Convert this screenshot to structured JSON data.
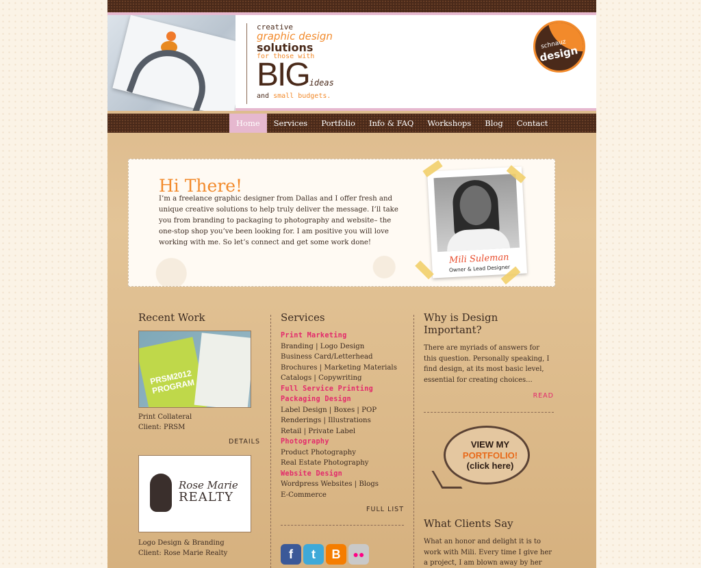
{
  "header": {
    "tag_creative": "creative",
    "tag_graphic_design": "graphic design",
    "tag_solutions": "solutions",
    "tag_for_those_with": "for those with",
    "tag_big": "BIG",
    "tag_ideas": "ideas",
    "tag_and": "and",
    "tag_small_budgets": "small budgets.",
    "logo_line1": "schnauz",
    "logo_line2": "design"
  },
  "nav": {
    "items": [
      "Home",
      "Services",
      "Portfolio",
      "Info & FAQ",
      "Workshops",
      "Blog",
      "Contact"
    ],
    "active": "Home"
  },
  "intro": {
    "heading": "Hi There!",
    "text": "I’m a freelance graphic designer from Dallas and I offer fresh and unique creative solutions to help truly deliver the message. I’ll take you from branding to packaging to photography and website– the one-stop shop you’ve been looking for. I am positive you will love working with me. So let’s connect and get some work done!",
    "name": "Mili Suleman",
    "role": "Owner & Lead Designer"
  },
  "recent_work": {
    "title": "Recent Work",
    "item1_book_text": "PRSM2012 PROGRAM",
    "item1_line1": "Print Collateral",
    "item1_line2": "Client: PRSM",
    "details": "DETAILS",
    "item2_logo_line1": "Rose Marie",
    "item2_logo_line2": "REALTY",
    "item2_line1": "Logo Design & Branding",
    "item2_line2": "Client: Rose Marie Realty"
  },
  "services": {
    "title": "Services",
    "lines": [
      {
        "text": "Print Marketing",
        "cat": true
      },
      {
        "text": "Branding | Logo Design",
        "cat": false
      },
      {
        "text": "Business Card/Letterhead",
        "cat": false
      },
      {
        "text": "Brochures | Marketing Materials",
        "cat": false
      },
      {
        "text": "Catalogs | Copywriting",
        "cat": false
      },
      {
        "text": "Full Service Printing",
        "cat": true
      },
      {
        "text": "Packaging Design",
        "cat": true
      },
      {
        "text": "Label Design | Boxes | POP",
        "cat": false
      },
      {
        "text": "Renderings | Illustrations",
        "cat": false
      },
      {
        "text": "Retail | Private Label",
        "cat": false
      },
      {
        "text": "Photography",
        "cat": true
      },
      {
        "text": "Product Photography",
        "cat": false
      },
      {
        "text": "Real Estate Photography",
        "cat": false
      },
      {
        "text": "Website Design",
        "cat": true
      },
      {
        "text": "Wordpress Websites | Blogs",
        "cat": false
      },
      {
        "text": "E-Commerce",
        "cat": false
      }
    ],
    "full_list": "FULL LIST"
  },
  "why": {
    "title": "Why is Design Important?",
    "text": "There are myriads of answers for this question. Personally speaking, I find design, at its most basic level, essential for creating choices...",
    "read": "READ"
  },
  "portfolio_bubble": {
    "line1": "VIEW MY",
    "line2": "PORTFOLIO!",
    "line3": "(click here)"
  },
  "clients": {
    "title": "What Clients Say",
    "text": "What an honor and delight it is to work with Mili. Every time I give her a project, I am blown away by her work."
  },
  "social": {
    "facebook": "f",
    "twitter": "t",
    "blogger": "B",
    "flickr": "●●"
  }
}
